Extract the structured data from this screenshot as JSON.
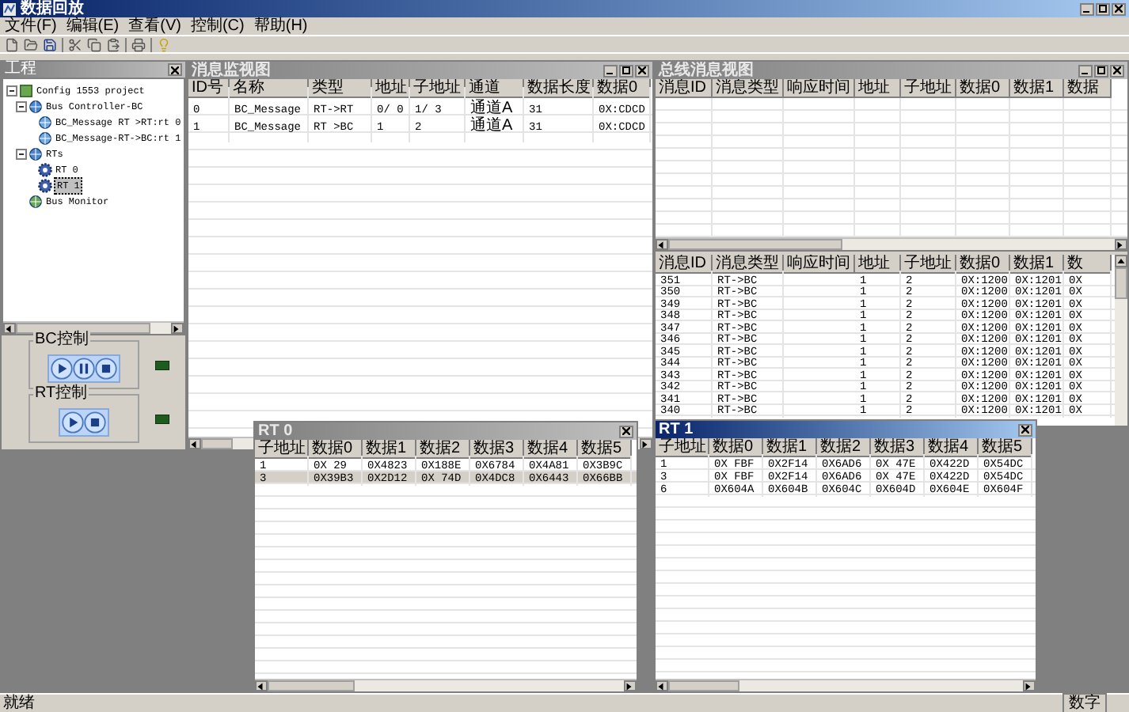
{
  "window": {
    "title": "数据回放"
  },
  "menu": [
    "文件(F)",
    "编辑(E)",
    "查看(V)",
    "控制(C)",
    "帮助(H)"
  ],
  "project_panel": {
    "title": "工程",
    "tree": [
      {
        "label": "Config 1553 project",
        "kind": "project",
        "expanded": true,
        "selected": false,
        "children": [
          {
            "label": "Bus Controller-BC",
            "kind": "controller",
            "expanded": true,
            "selected": false,
            "children": [
              {
                "label": "BC_Message RT >RT:rt 0",
                "kind": "message",
                "selected": false
              },
              {
                "label": "BC_Message-RT->BC:rt 1",
                "kind": "message",
                "selected": false
              }
            ]
          },
          {
            "label": "RTs",
            "kind": "group",
            "expanded": true,
            "selected": false,
            "children": [
              {
                "label": "RT 0",
                "kind": "rt",
                "selected": false
              },
              {
                "label": "RT 1",
                "kind": "rt",
                "selected": true
              }
            ]
          },
          {
            "label": "Bus Monitor",
            "kind": "monitor",
            "selected": false
          }
        ]
      }
    ]
  },
  "controls": [
    {
      "title": "BC控制",
      "buttons": [
        {
          "kind": "play"
        },
        {
          "kind": "pause"
        },
        {
          "kind": "stop"
        }
      ]
    },
    {
      "title": "RT控制",
      "buttons": [
        {
          "kind": "play"
        },
        {
          "kind": "stop"
        }
      ]
    }
  ],
  "message_view": {
    "title": "消息监视图",
    "active": false,
    "columns": [
      "ID号",
      "名称",
      "类型",
      "地址",
      "子地址",
      "通道",
      "数据长度",
      "数据0"
    ],
    "rows": [
      [
        "0",
        "BC_Message",
        "RT->RT",
        "0/ 0",
        "1/ 3",
        "通道A",
        "31",
        "0X:CDCD"
      ],
      [
        "1",
        "BC_Message",
        "RT >BC",
        "1",
        "2",
        "通道A",
        "31",
        "0X:CDCD"
      ]
    ]
  },
  "bus_view": {
    "title": "总线消息视图",
    "active": false,
    "columns": [
      "消息ID",
      "消息类型",
      "响应时间",
      "地址",
      "子地址",
      "数据0",
      "数据1",
      "数据"
    ],
    "monitor_columns": [
      "消息ID",
      "消息类型",
      "响应时间",
      "地址",
      "子地址",
      "数据0",
      "数据1",
      "数"
    ],
    "monitor_rows": [
      [
        "351",
        "RT->BC",
        "",
        "1",
        "2",
        "0X:1200",
        "0X:1201",
        "0X"
      ],
      [
        "350",
        "RT->BC",
        "",
        "1",
        "2",
        "0X:1200",
        "0X:1201",
        "0X"
      ],
      [
        "349",
        "RT->BC",
        "",
        "1",
        "2",
        "0X:1200",
        "0X:1201",
        "0X"
      ],
      [
        "348",
        "RT->BC",
        "",
        "1",
        "2",
        "0X:1200",
        "0X:1201",
        "0X"
      ],
      [
        "347",
        "RT->BC",
        "",
        "1",
        "2",
        "0X:1200",
        "0X:1201",
        "0X"
      ],
      [
        "346",
        "RT->BC",
        "",
        "1",
        "2",
        "0X:1200",
        "0X:1201",
        "0X"
      ],
      [
        "345",
        "RT->BC",
        "",
        "1",
        "2",
        "0X:1200",
        "0X:1201",
        "0X"
      ],
      [
        "344",
        "RT->BC",
        "",
        "1",
        "2",
        "0X:1200",
        "0X:1201",
        "0X"
      ],
      [
        "343",
        "RT->BC",
        "",
        "1",
        "2",
        "0X:1200",
        "0X:1201",
        "0X"
      ],
      [
        "342",
        "RT->BC",
        "",
        "1",
        "2",
        "0X:1200",
        "0X:1201",
        "0X"
      ],
      [
        "341",
        "RT->BC",
        "",
        "1",
        "2",
        "0X:1200",
        "0X:1201",
        "0X"
      ],
      [
        "340",
        "RT->BC",
        "",
        "1",
        "2",
        "0X:1200",
        "0X:1201",
        "0X"
      ]
    ]
  },
  "rt_windows": [
    {
      "title": "RT 0",
      "active": false,
      "columns": [
        "子地址",
        "数据0",
        "数据1",
        "数据2",
        "数据3",
        "数据4",
        "数据5"
      ],
      "rows": [
        {
          "cells": [
            "1",
            "0X  29",
            "0X4823",
            "0X188E",
            "0X6784",
            "0X4A81",
            "0X3B9C"
          ],
          "selected": false
        },
        {
          "cells": [
            "3",
            "0X39B3",
            "0X2D12",
            "0X 74D",
            "0X4DC8",
            "0X6443",
            "0X66BB"
          ],
          "selected": true
        }
      ]
    },
    {
      "title": "RT 1",
      "active": true,
      "columns": [
        "子地址",
        "数据0",
        "数据1",
        "数据2",
        "数据3",
        "数据4",
        "数据5"
      ],
      "rows": [
        {
          "cells": [
            "1",
            "0X FBF",
            "0X2F14",
            "0X6AD6",
            "0X 47E",
            "0X422D",
            "0X54DC"
          ],
          "selected": false
        },
        {
          "cells": [
            "3",
            "0X FBF",
            "0X2F14",
            "0X6AD6",
            "0X 47E",
            "0X422D",
            "0X54DC"
          ],
          "selected": false
        },
        {
          "cells": [
            "6",
            "0X604A",
            "0X604B",
            "0X604C",
            "0X604D",
            "0X604E",
            "0X604F"
          ],
          "selected": false
        }
      ]
    }
  ],
  "status_bar": {
    "message": "就绪",
    "indicator": "数字"
  }
}
